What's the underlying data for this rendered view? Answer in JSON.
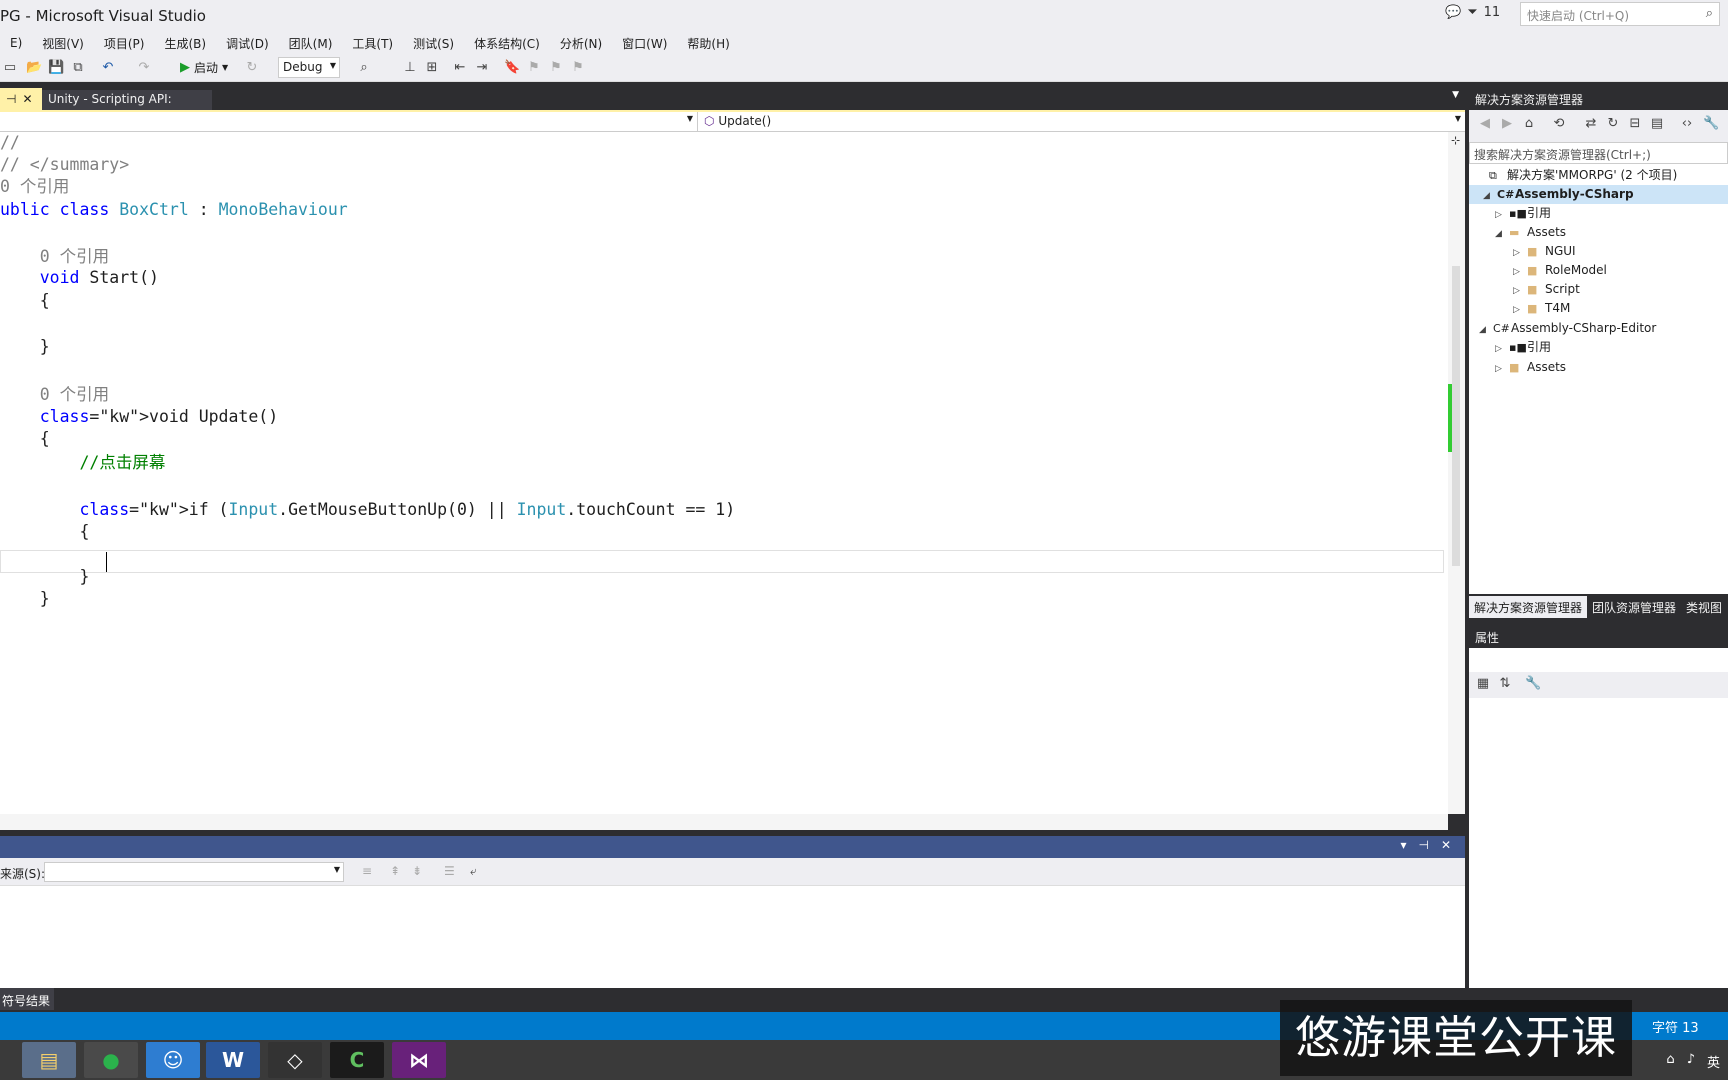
{
  "window": {
    "title": "PG - Microsoft Visual Studio",
    "notifications": "11",
    "quick_launch_placeholder": "快速启动 (Ctrl+Q)"
  },
  "menu": [
    "E)",
    "视图(V)",
    "项目(P)",
    "生成(B)",
    "调试(D)",
    "团队(M)",
    "工具(T)",
    "测试(S)",
    "体系结构(C)",
    "分析(N)",
    "窗口(W)",
    "帮助(H)"
  ],
  "toolbar": {
    "start_label": "启动",
    "config": "Debug"
  },
  "tabs": {
    "active_pin": "⊣",
    "doc_tab": "Unity - Scripting API:"
  },
  "navbar": {
    "member": "Update()"
  },
  "code": [
    {
      "text": "//"
    },
    {
      "text": "// </summary>"
    },
    {
      "text": "0 个引用"
    },
    {
      "a": "ublic class ",
      "b": "BoxCtrl",
      "c": " : ",
      "d": "MonoBehaviour"
    },
    {
      "text": ""
    },
    {
      "text": "    0 个引用"
    },
    {
      "text": "    void Start()"
    },
    {
      "text": "    {"
    },
    {
      "text": ""
    },
    {
      "text": "    }"
    },
    {
      "text": ""
    },
    {
      "text": "    0 个引用"
    },
    {
      "text": "    void Update()"
    },
    {
      "text": "    {"
    },
    {
      "text": "        //点击屏幕"
    },
    {
      "text": ""
    },
    {
      "text": "        if (Input.GetMouseButtonUp(0) || Input.touchCount == 1)"
    },
    {
      "text": "        {"
    },
    {
      "text": ""
    },
    {
      "text": "        }"
    },
    {
      "text": "    }"
    }
  ],
  "output": {
    "source_label": "来源(S):"
  },
  "bottom_tab": "符号结果",
  "solution": {
    "title": "解决方案资源管理器",
    "search_placeholder": "搜索解决方案资源管理器(Ctrl+;)",
    "items": [
      {
        "label": "解决方案'MMORPG' (2 个项目)"
      },
      {
        "label": "Assembly-CSharp"
      },
      {
        "label": "引用"
      },
      {
        "label": "Assets"
      },
      {
        "label": "NGUI"
      },
      {
        "label": "RoleModel"
      },
      {
        "label": "Script"
      },
      {
        "label": "T4M"
      },
      {
        "label": "Assembly-CSharp-Editor"
      },
      {
        "label": "引用"
      },
      {
        "label": "Assets"
      }
    ],
    "tabs": [
      "解决方案资源管理器",
      "团队资源管理器",
      "类视图"
    ]
  },
  "properties": {
    "title": "属性"
  },
  "status": {
    "char": "字符 13"
  },
  "watermark": "悠游课堂公开课",
  "tray": {
    "lang": "英"
  },
  "colors": {
    "accent": "#007acc",
    "keyword": "#0000ff",
    "type": "#2b91af",
    "comment": "#008000"
  }
}
